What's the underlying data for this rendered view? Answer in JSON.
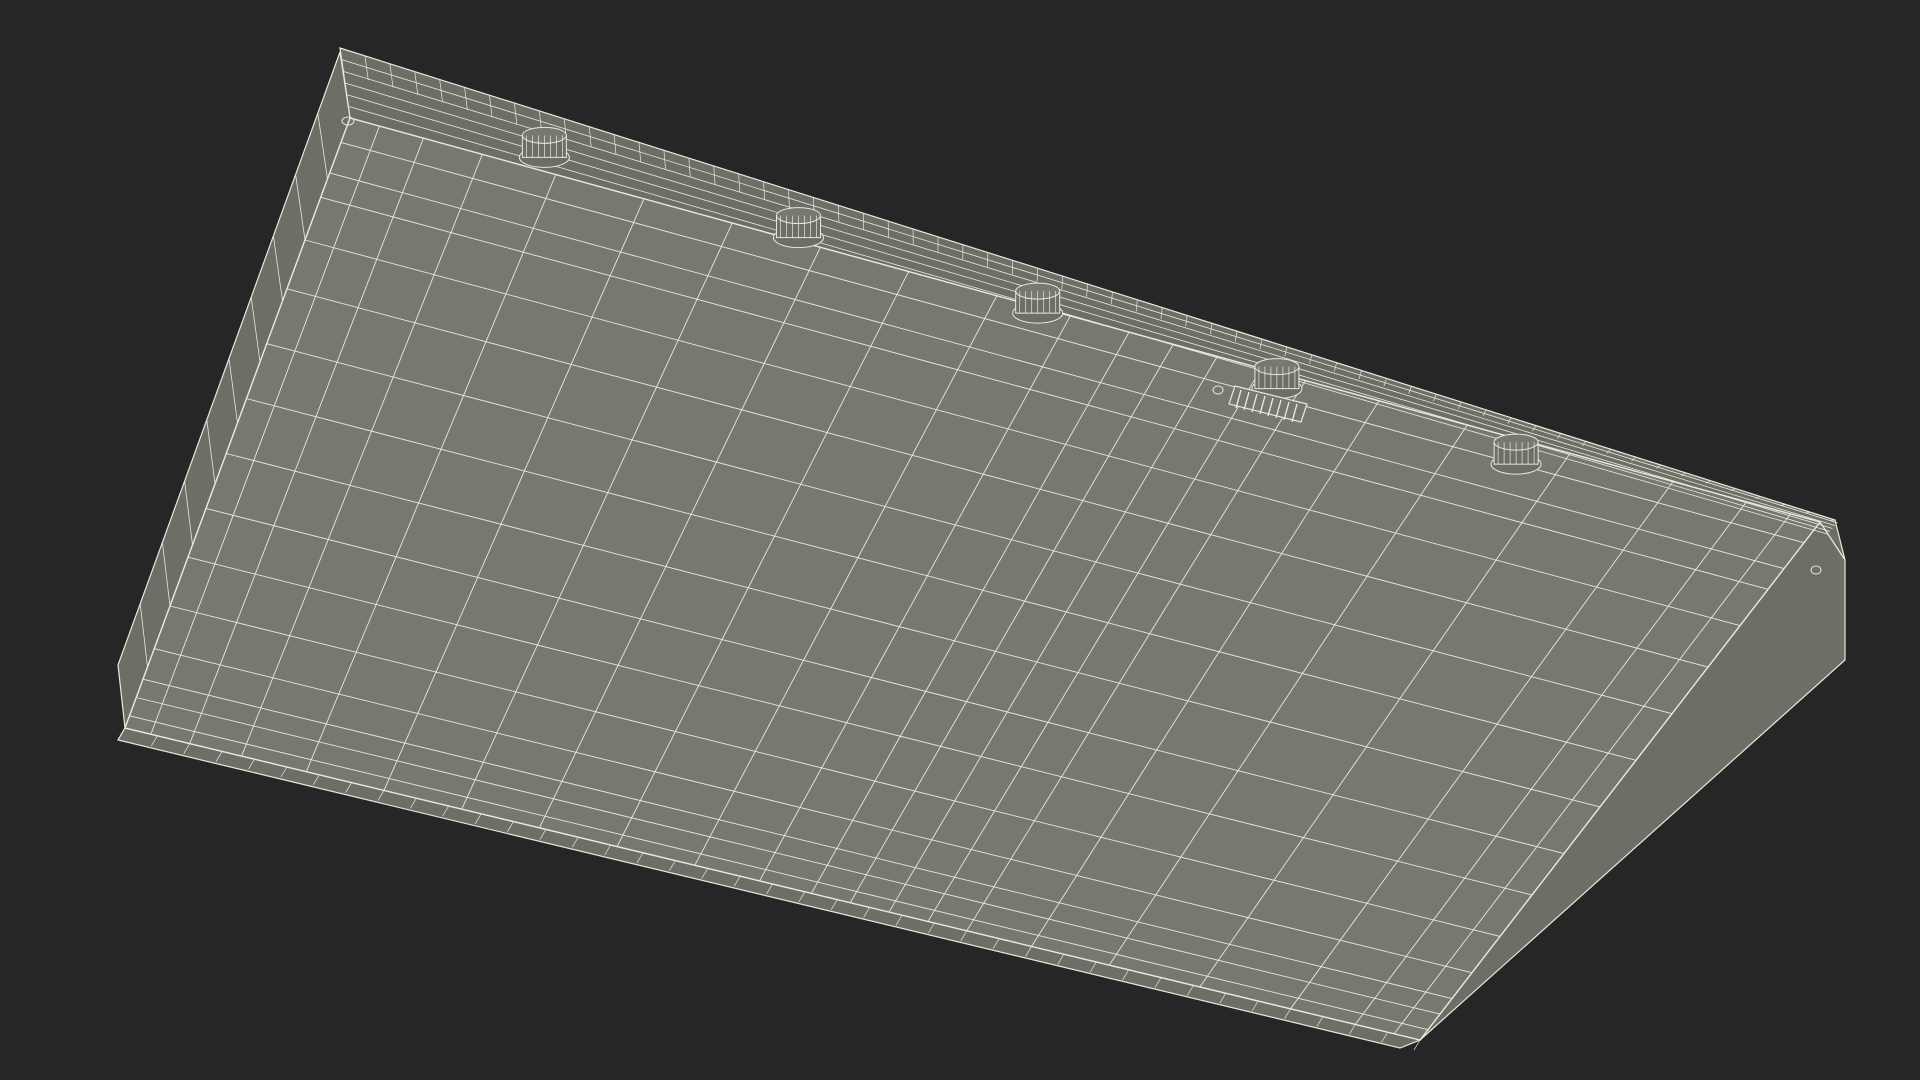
{
  "scene": {
    "background_color": "#262626",
    "surface_color": "#787870",
    "side_color": "#6e6e67",
    "wire_color": "#e8e8dc",
    "object": "wireframe-box-underside",
    "feet_count": 5,
    "vent_slats": 8
  }
}
